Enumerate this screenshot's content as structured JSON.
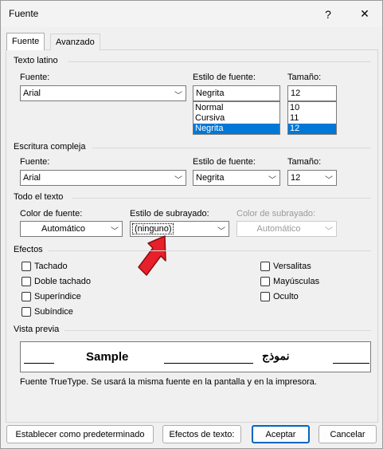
{
  "window": {
    "title": "Fuente",
    "help_glyph": "?",
    "close_glyph": "✕"
  },
  "tabs": [
    {
      "label": "Fuente",
      "active": true
    },
    {
      "label": "Avanzado",
      "active": false
    }
  ],
  "latin": {
    "group_title": "Texto latino",
    "font_label": "Fuente:",
    "font_value": "Arial",
    "style_label": "Estilo de fuente:",
    "style_value": "Negrita",
    "style_options": [
      "Normal",
      "Cursiva",
      "Negrita"
    ],
    "style_selected": "Negrita",
    "size_label": "Tamaño:",
    "size_value": "12",
    "size_options": [
      "10",
      "11",
      "12"
    ],
    "size_selected": "12"
  },
  "complex": {
    "group_title": "Escritura compleja",
    "font_label": "Fuente:",
    "font_value": "Arial",
    "style_label": "Estilo de fuente:",
    "style_value": "Negrita",
    "size_label": "Tamaño:",
    "size_value": "12"
  },
  "all_text": {
    "group_title": "Todo el texto",
    "color_label": "Color de fuente:",
    "color_value": "Automático",
    "underline_style_label": "Estilo de subrayado:",
    "underline_style_value": "(ninguno)",
    "underline_color_label": "Color de subrayado:",
    "underline_color_value": "Automático"
  },
  "effects": {
    "group_title": "Efectos",
    "left": [
      {
        "label": "Tachado",
        "checked": false
      },
      {
        "label": "Doble tachado",
        "checked": false
      },
      {
        "label": "Superíndice",
        "checked": false
      },
      {
        "label": "Subíndice",
        "checked": false
      }
    ],
    "right": [
      {
        "label": "Versalitas",
        "checked": false
      },
      {
        "label": "Mayúsculas",
        "checked": false
      },
      {
        "label": "Oculto",
        "checked": false
      }
    ]
  },
  "preview": {
    "group_title": "Vista previa",
    "sample_latin": "Sample",
    "sample_complex": "نموذج",
    "note": "Fuente TrueType. Se usará la misma fuente en la pantalla y en la impresora."
  },
  "buttons": {
    "set_default": "Establecer como predeterminado",
    "text_effects": "Efectos de texto:",
    "accept": "Aceptar",
    "cancel": "Cancelar"
  },
  "colors": {
    "selection": "#0078d7",
    "primary_border": "#0067c0",
    "annotation_arrow": "#e8202a"
  }
}
